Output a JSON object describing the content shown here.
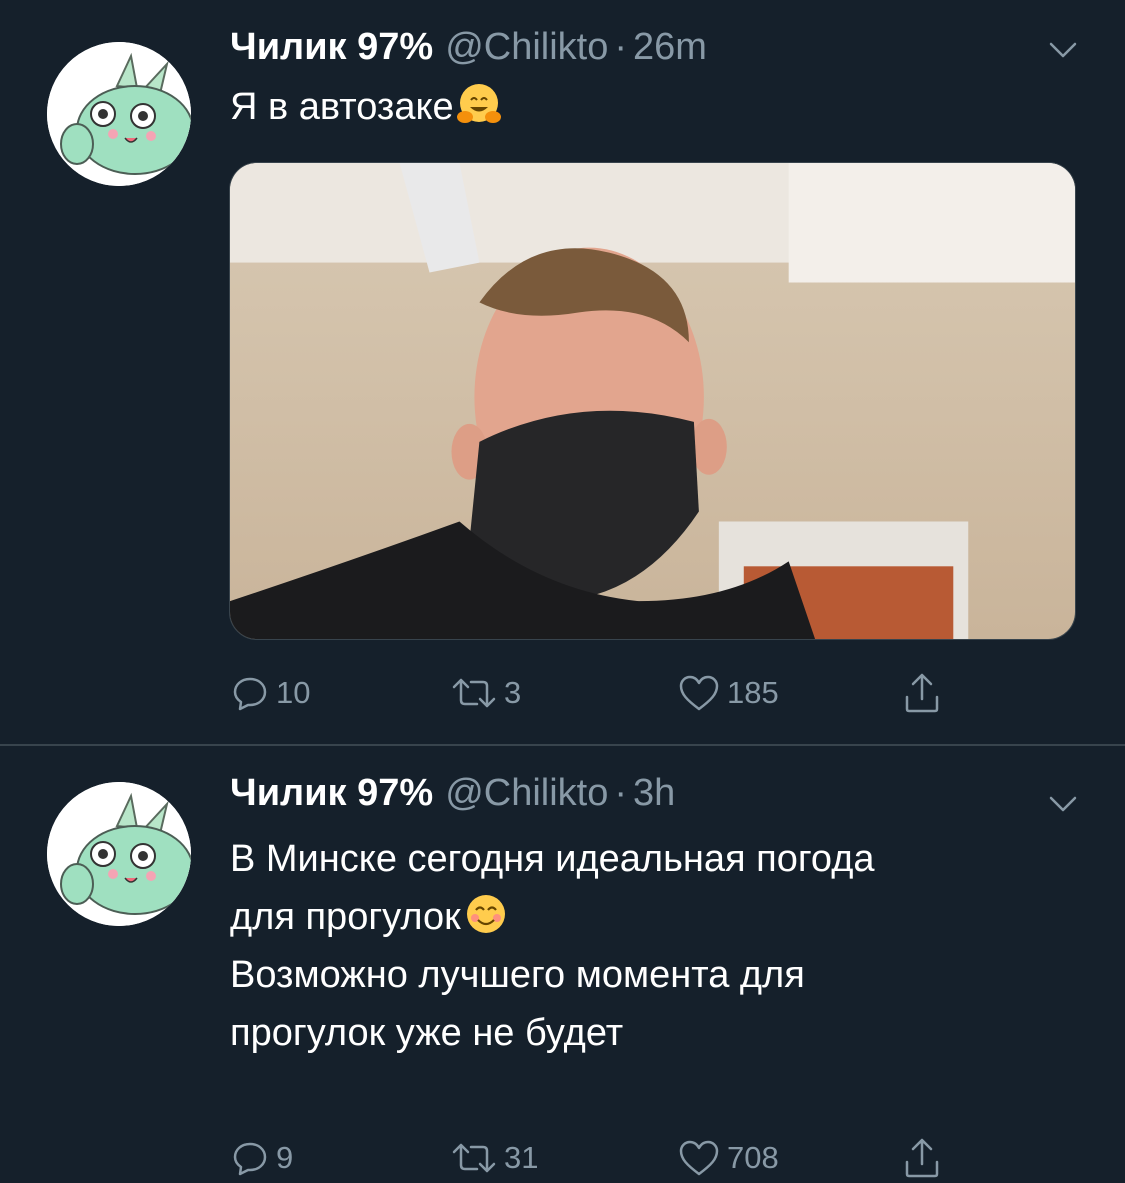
{
  "colors": {
    "background": "#15202b",
    "secondary_text": "#8899a6",
    "divider": "#38444d",
    "text": "#ffffff"
  },
  "tweets": [
    {
      "display_name": "Чилик 97%",
      "handle": "@Chilikto",
      "separator": "·",
      "time": "26m",
      "text_lines": [
        "Я в автозаке"
      ],
      "emoji": "hugging-face",
      "has_photo": true,
      "replies": "10",
      "retweets": "3",
      "likes": "185"
    },
    {
      "display_name": "Чилик 97%",
      "handle": "@Chilikto",
      "separator": "·",
      "time": "3h",
      "text_lines": [
        "В Минске сегодня идеальная погода",
        "для прогулок",
        "Возможно лучшего момента для",
        "прогулок уже не будет"
      ],
      "emoji": "smiling-face",
      "has_photo": false,
      "replies": "9",
      "retweets": "31",
      "likes": "708"
    }
  ]
}
